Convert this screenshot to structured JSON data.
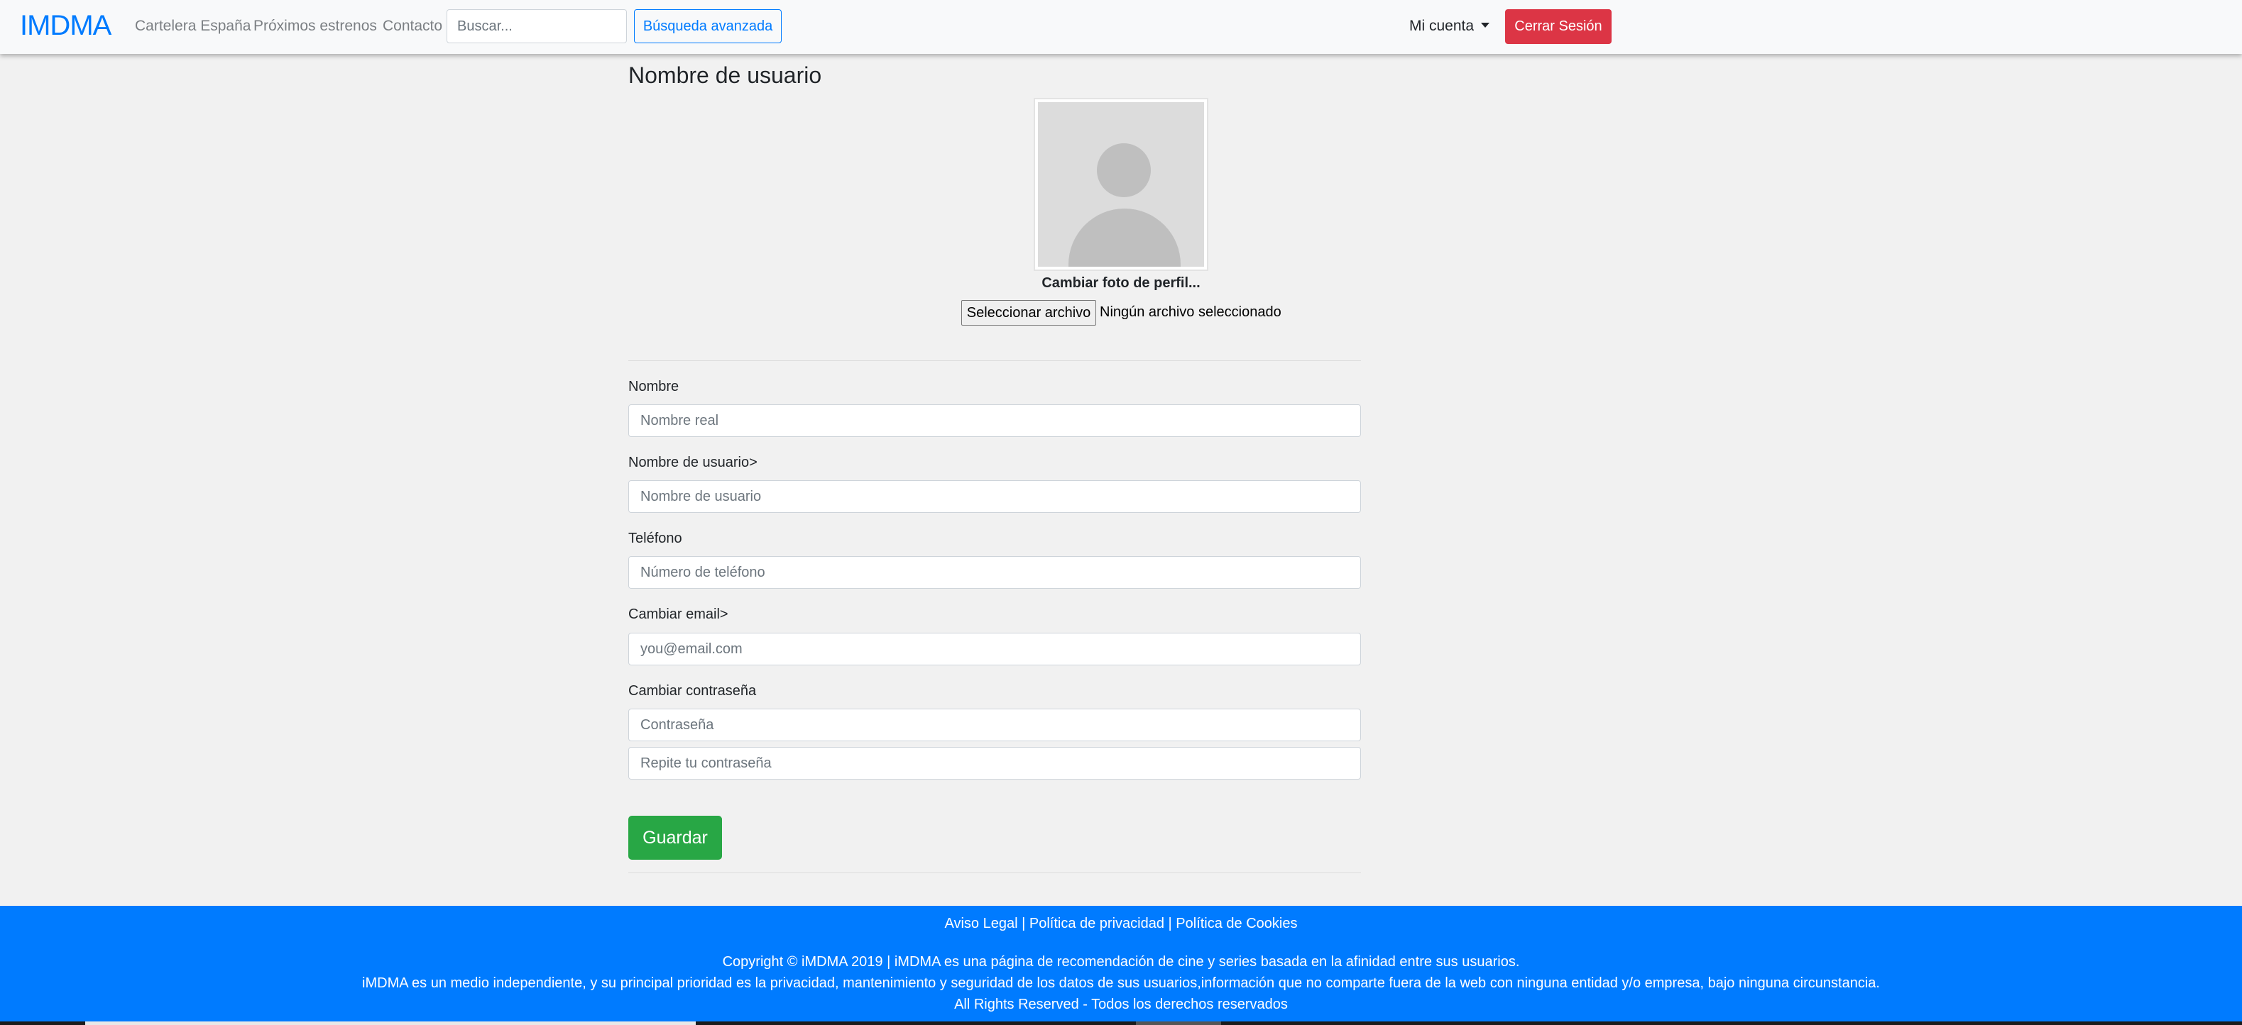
{
  "navbar": {
    "brand": "IMDMA",
    "links": [
      "Cartelera España",
      "Próximos estrenos",
      "Contacto"
    ],
    "search_placeholder": "Buscar...",
    "advanced_search": "Búsqueda avanzada",
    "account": "Mi cuenta",
    "logout": "Cerrar Sesión"
  },
  "profile": {
    "title": "Nombre de usuario",
    "change_photo": "Cambiar foto de perfil...",
    "file_button": "Seleccionar archivo",
    "file_status": "Ningún archivo seleccionado"
  },
  "form": {
    "name_label": "Nombre",
    "name_placeholder": "Nombre real",
    "username_label": "Nombre de usuario>",
    "username_placeholder": "Nombre de usuario",
    "phone_label": "Teléfono",
    "phone_placeholder": "Número de teléfono",
    "email_label": "Cambiar email>",
    "email_placeholder": "you@email.com",
    "password_label": "Cambiar contraseña",
    "password_placeholder": "Contraseña",
    "password_repeat_placeholder": "Repite tu contraseña",
    "save": "Guardar"
  },
  "footer": {
    "legal": "Aviso Legal",
    "privacy": "Política de privacidad",
    "cookies": "Política de Cookies",
    "separator": " | ",
    "copyright": "Copyright © iMDMA 2019 | iMDMA es una página de recomendación de cine y series basada en la afinidad entre sus usuarios.",
    "independence": "iMDMA es un medio independiente, y su principal prioridad es la privacidad, mantenimiento y seguridad de los datos de sus usuarios,información que no comparte fuera de la web con ninguna entidad y/o empresa, bajo ninguna circunstancia.",
    "rights": "All Rights Reserved - Todos los derechos reservados"
  },
  "colors": {
    "primary": "#007bff",
    "danger": "#dc3545",
    "success": "#28a745"
  }
}
